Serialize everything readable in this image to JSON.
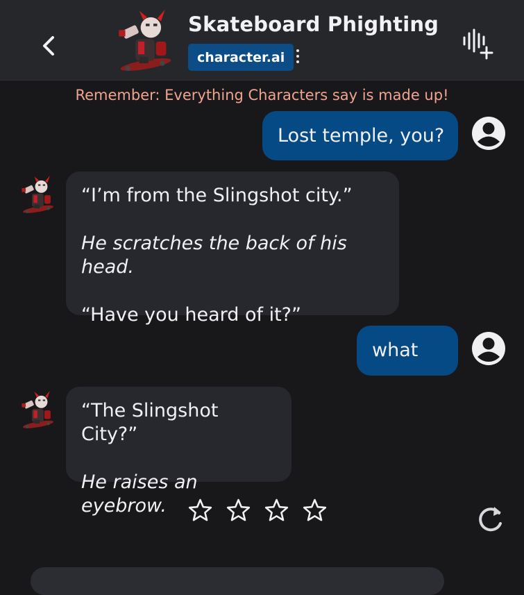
{
  "header": {
    "character_name": "Skateboard Phighting",
    "creator_badge": "character.ai",
    "back_icon": "chevron-left-icon",
    "menu_icon": "more-vertical-icon",
    "voice_icon": "voice-add-icon"
  },
  "disclaimer": "Remember: Everything Characters say is made up!",
  "messages": [
    {
      "role": "user",
      "text": "Lost temple, you?"
    },
    {
      "role": "character",
      "lines": [
        "“I’m from the Slingshot city.”",
        "He scratches the back of his head.",
        "“Have you heard of it?”"
      ]
    },
    {
      "role": "user",
      "text": "what"
    },
    {
      "role": "character",
      "lines": [
        "“The Slingshot City?”",
        "He raises an eyebrow."
      ]
    }
  ],
  "rating": {
    "stars": 4,
    "selected": 0
  },
  "colors": {
    "background": "#18181b",
    "header": "#26272b",
    "user_bubble": "#054985",
    "character_bubble": "#27282d",
    "badge": "#0c4d87",
    "disclaimer": "#f0a48f"
  }
}
